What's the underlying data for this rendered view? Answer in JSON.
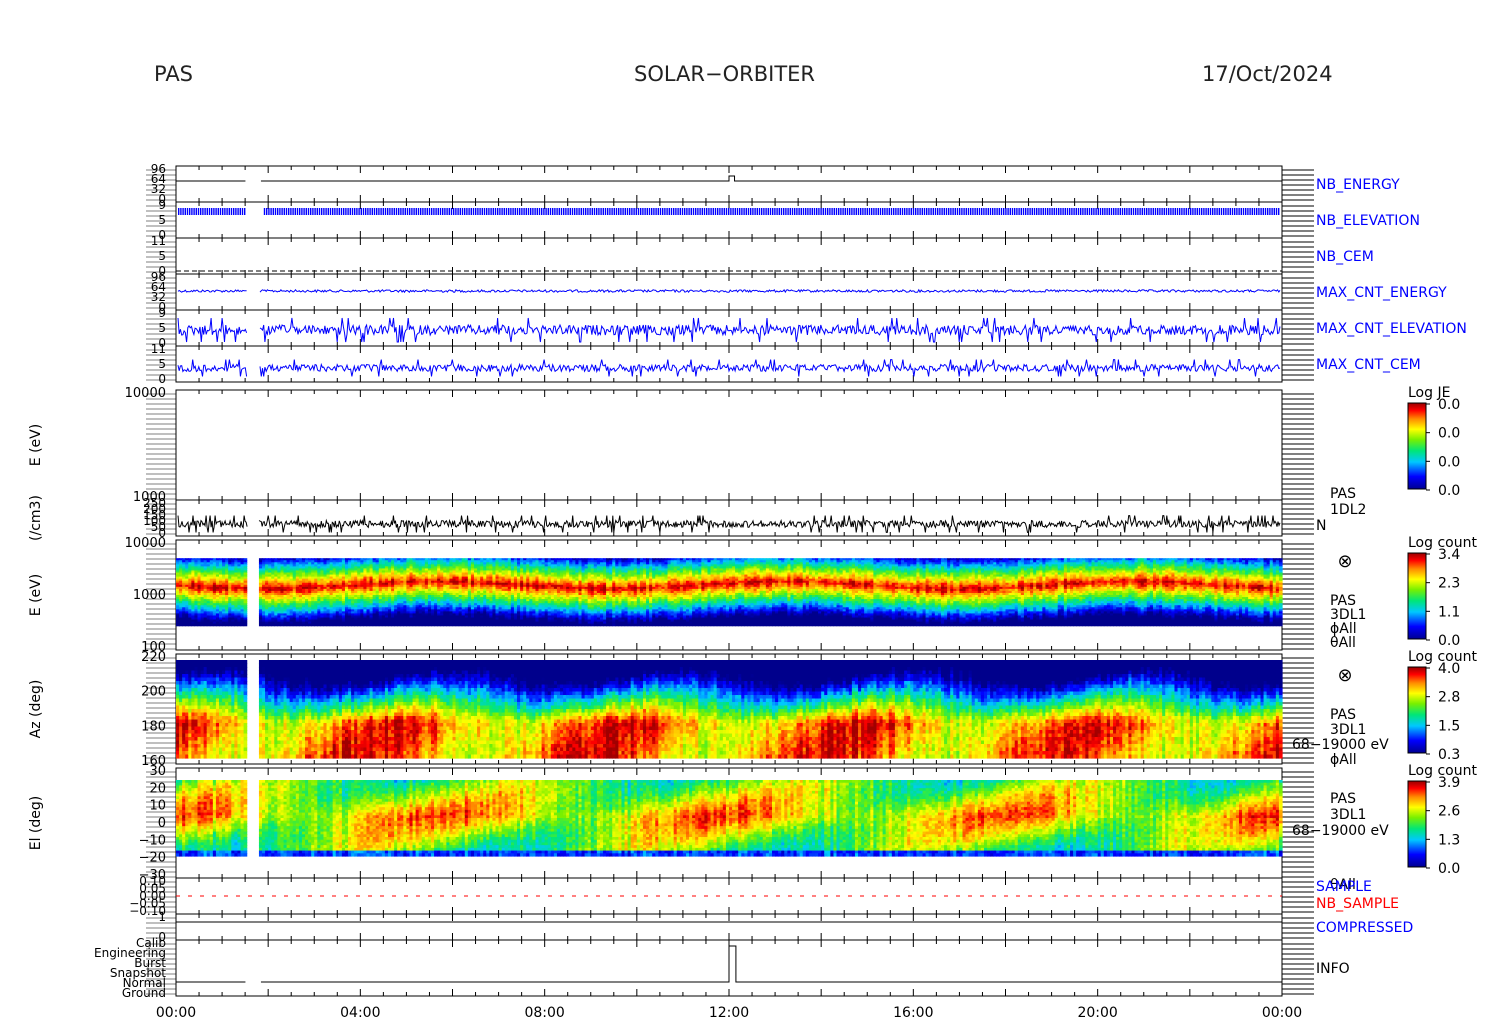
{
  "header": {
    "left": "PAS",
    "center": "SOLAR−ORBITER",
    "right": "17/Oct/2024"
  },
  "colors": {
    "blue": "#0000ff",
    "red": "#ff0000",
    "black": "#000000"
  },
  "chart_data": {
    "type": "heatmap",
    "x_ticks": [
      "00:00",
      "04:00",
      "08:00",
      "12:00",
      "16:00",
      "20:00",
      "00:00"
    ],
    "x_range_hours": [
      0,
      24
    ],
    "data_gap_hours": [
      1.55,
      1.8
    ],
    "panels": [
      {
        "id": "nb-energy",
        "label": "NB_ENERGY",
        "label_color": "blue",
        "tick_labels": [
          "96",
          "64",
          "32",
          "0"
        ],
        "type": "line"
      },
      {
        "id": "nb-elevation",
        "label": "NB_ELEVATION",
        "label_color": "blue",
        "tick_labels": [
          "9",
          "5",
          "0"
        ],
        "type": "line"
      },
      {
        "id": "nb-cem",
        "label": "NB_CEM",
        "label_color": "blue",
        "tick_labels": [
          "11",
          "5",
          "0"
        ],
        "type": "line"
      },
      {
        "id": "max-cnt-energy",
        "label": "MAX_CNT_ENERGY",
        "label_color": "blue",
        "tick_labels": [
          "96",
          "64",
          "32",
          "0"
        ],
        "type": "line"
      },
      {
        "id": "max-cnt-elevation",
        "label": "MAX_CNT_ELEVATION",
        "label_color": "blue",
        "tick_labels": [
          "9",
          "5",
          "0"
        ],
        "type": "line"
      },
      {
        "id": "max-cnt-cem",
        "label": "MAX_CNT_CEM",
        "label_color": "blue",
        "tick_labels": [
          "11",
          "5",
          "0"
        ],
        "type": "line"
      },
      {
        "id": "energy-empty",
        "ylabel": "E (eV)",
        "tick_labels": [
          "10000",
          "1000"
        ],
        "type": "spectrogram",
        "colorbar": {
          "title": "Log JE",
          "ticks": [
            "0.0",
            "0.0",
            "0.0",
            "0.0"
          ]
        }
      },
      {
        "id": "density",
        "ylabel": "(/cm3)",
        "tick_labels": [
          "250",
          "200",
          "150",
          "100",
          "50",
          "0"
        ],
        "type": "line",
        "labels": [
          "PAS",
          "1DL2",
          "N"
        ]
      },
      {
        "id": "energy-spectrogram",
        "ylabel": "E (eV)",
        "tick_labels": [
          "10000",
          "1000",
          "100"
        ],
        "type": "spectrogram",
        "labels": [
          "PAS",
          "3DL1",
          "ϕAll",
          "θAll"
        ],
        "colorbar": {
          "title": "Log count",
          "ticks": [
            "3.4",
            "2.3",
            "1.1",
            "0.0"
          ]
        }
      },
      {
        "id": "azimuth-spectrogram",
        "ylabel": "Az (deg)",
        "tick_labels": [
          "220",
          "200",
          "180",
          "160"
        ],
        "type": "spectrogram",
        "labels": [
          "PAS",
          "3DL1",
          "68−19000 eV",
          "ϕAll"
        ],
        "colorbar": {
          "title": "Log count",
          "ticks": [
            "4.0",
            "2.8",
            "1.5",
            "0.3"
          ]
        }
      },
      {
        "id": "elevation-spectrogram",
        "ylabel": "El (deg)",
        "tick_labels": [
          "30",
          "20",
          "10",
          "0",
          "−10",
          "−20",
          "−30"
        ],
        "type": "spectrogram",
        "labels": [
          "PAS",
          "3DL1",
          "68−19000 eV",
          "θAll"
        ],
        "colorbar": {
          "title": "Log count",
          "ticks": [
            "3.9",
            "2.6",
            "1.3",
            "0.0"
          ]
        }
      },
      {
        "id": "sample",
        "labels": [
          "SAMPLE",
          "NB_SAMPLE"
        ],
        "label_colors": [
          "blue",
          "red"
        ],
        "tick_labels": [
          "0.10",
          "0.05",
          "0.00",
          "−0.05",
          "−0.10"
        ],
        "type": "line"
      },
      {
        "id": "compressed",
        "label": "COMPRESSED",
        "label_color": "blue",
        "tick_labels": [
          "1",
          "0"
        ],
        "type": "line"
      },
      {
        "id": "info",
        "label": "INFO",
        "label_color": "black",
        "tick_labels": [
          "Calib",
          "Engineering",
          "Burst",
          "Snapshot",
          "Normal",
          "Ground"
        ],
        "type": "line"
      }
    ]
  }
}
